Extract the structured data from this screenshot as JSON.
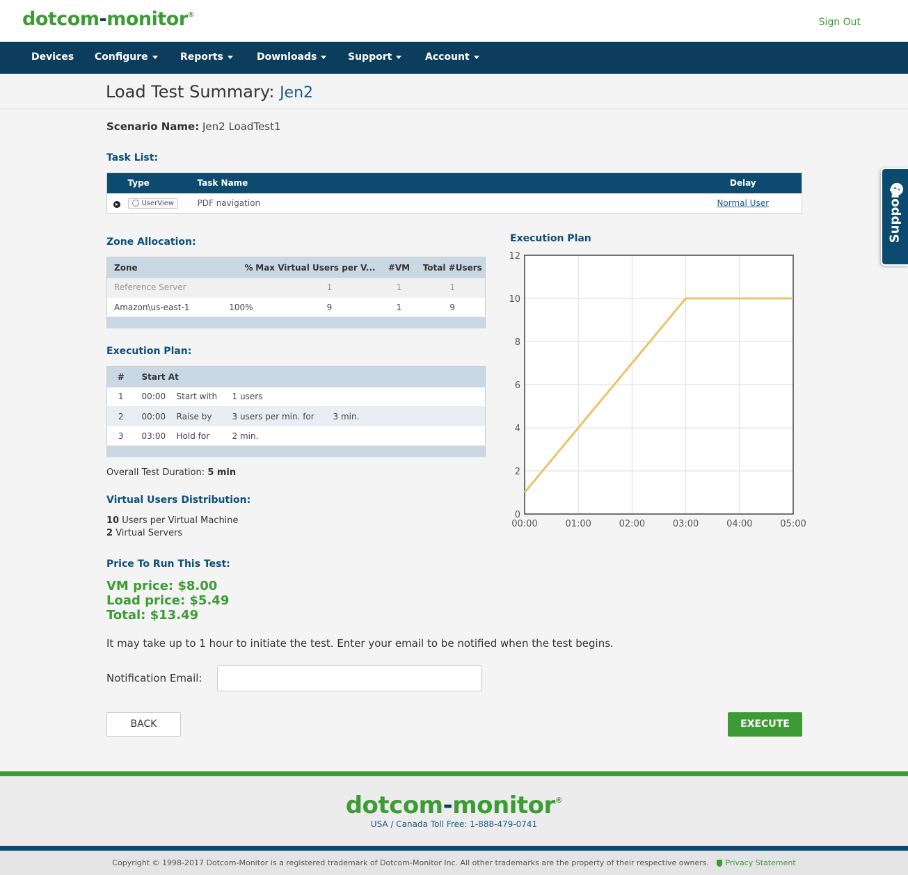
{
  "header": {
    "logo_part1": "dotcom",
    "logo_dash": "-",
    "logo_part2": "monitor",
    "logo_reg": "®",
    "sign_out": "Sign Out"
  },
  "nav": {
    "items": [
      {
        "label": "Devices",
        "dropdown": false
      },
      {
        "label": "Configure",
        "dropdown": true
      },
      {
        "label": "Reports",
        "dropdown": true
      },
      {
        "label": "Downloads",
        "dropdown": true
      },
      {
        "label": "Support",
        "dropdown": true
      },
      {
        "label": "Account",
        "dropdown": true
      }
    ]
  },
  "page": {
    "title": "Load Test Summary:",
    "title_name": "Jen2",
    "scenario_label": "Scenario Name:",
    "scenario_value": "Jen2 LoadTest1"
  },
  "task_list": {
    "title": "Task List:",
    "headers": {
      "type": "Type",
      "task_name": "Task Name",
      "delay": "Delay"
    },
    "rows": [
      {
        "type": "UserView",
        "task_name": "PDF navigation",
        "delay": "Normal User"
      }
    ]
  },
  "zone_allocation": {
    "title": "Zone Allocation:",
    "headers": {
      "zone": "Zone",
      "pct": "%",
      "max_vu": "Max Virtual Users per V...",
      "vm": "#VM",
      "total": "Total #Users"
    },
    "rows": [
      {
        "zone": "Reference Server",
        "pct": "",
        "max_vu": "1",
        "vm": "1",
        "total": "1"
      },
      {
        "zone": "Amazon\\us-east-1",
        "pct": "100%",
        "max_vu": "9",
        "vm": "1",
        "total": "9"
      }
    ]
  },
  "execution_plan": {
    "title": "Execution Plan:",
    "headers": {
      "num": "#",
      "start_at": "Start At"
    },
    "rows": [
      {
        "num": "1",
        "time": "00:00",
        "action": "Start with",
        "value": "1 users",
        "extra": ""
      },
      {
        "num": "2",
        "time": "00:00",
        "action": "Raise by",
        "value": "3 users per min. for",
        "extra": "3 min."
      },
      {
        "num": "3",
        "time": "03:00",
        "action": "Hold for",
        "value": "2 min.",
        "extra": ""
      }
    ],
    "duration_label": "Overall Test Duration:",
    "duration_value": "5 min"
  },
  "vu_distribution": {
    "title": "Virtual Users Distribution:",
    "users_per_vm_num": "10",
    "users_per_vm_text": "Users per Virtual Machine",
    "servers_num": "2",
    "servers_text": "Virtual Servers"
  },
  "price": {
    "title": "Price To Run This Test:",
    "vm": "VM price: $8.00",
    "load": "Load price: $5.49",
    "total": "Total: $13.49"
  },
  "notification": {
    "notice": "It may take up to 1 hour to initiate the test. Enter your email to be notified when the test begins.",
    "email_label": "Notification Email:",
    "email_value": "",
    "email_placeholder": ""
  },
  "buttons": {
    "back": "BACK",
    "execute": "EXECUTE"
  },
  "support_tab": {
    "label": "Support",
    "icon": "?"
  },
  "footer": {
    "phone": "USA / Canada Toll Free: 1-888-479-0741",
    "copyright": "Copyright © 1998-2017 Dotcom-Monitor is a registered trademark of Dotcom-Monitor Inc. All other trademarks are the property of their respective owners.",
    "privacy": "Privacy Statement"
  },
  "colors": {
    "brand_green": "#3d9b35",
    "brand_navy": "#0c3d5c",
    "line": "#e8c36a"
  },
  "chart_data": {
    "type": "line",
    "title": "Execution Plan",
    "x": [
      "00:00",
      "01:00",
      "02:00",
      "03:00",
      "04:00",
      "05:00"
    ],
    "series": [
      {
        "values": [
          1,
          4,
          7,
          10,
          10,
          10
        ]
      }
    ],
    "xlabel": "",
    "ylabel": "",
    "ylim": [
      0,
      12
    ],
    "yticks": [
      0,
      2,
      4,
      6,
      8,
      10,
      12
    ],
    "grid": true
  }
}
